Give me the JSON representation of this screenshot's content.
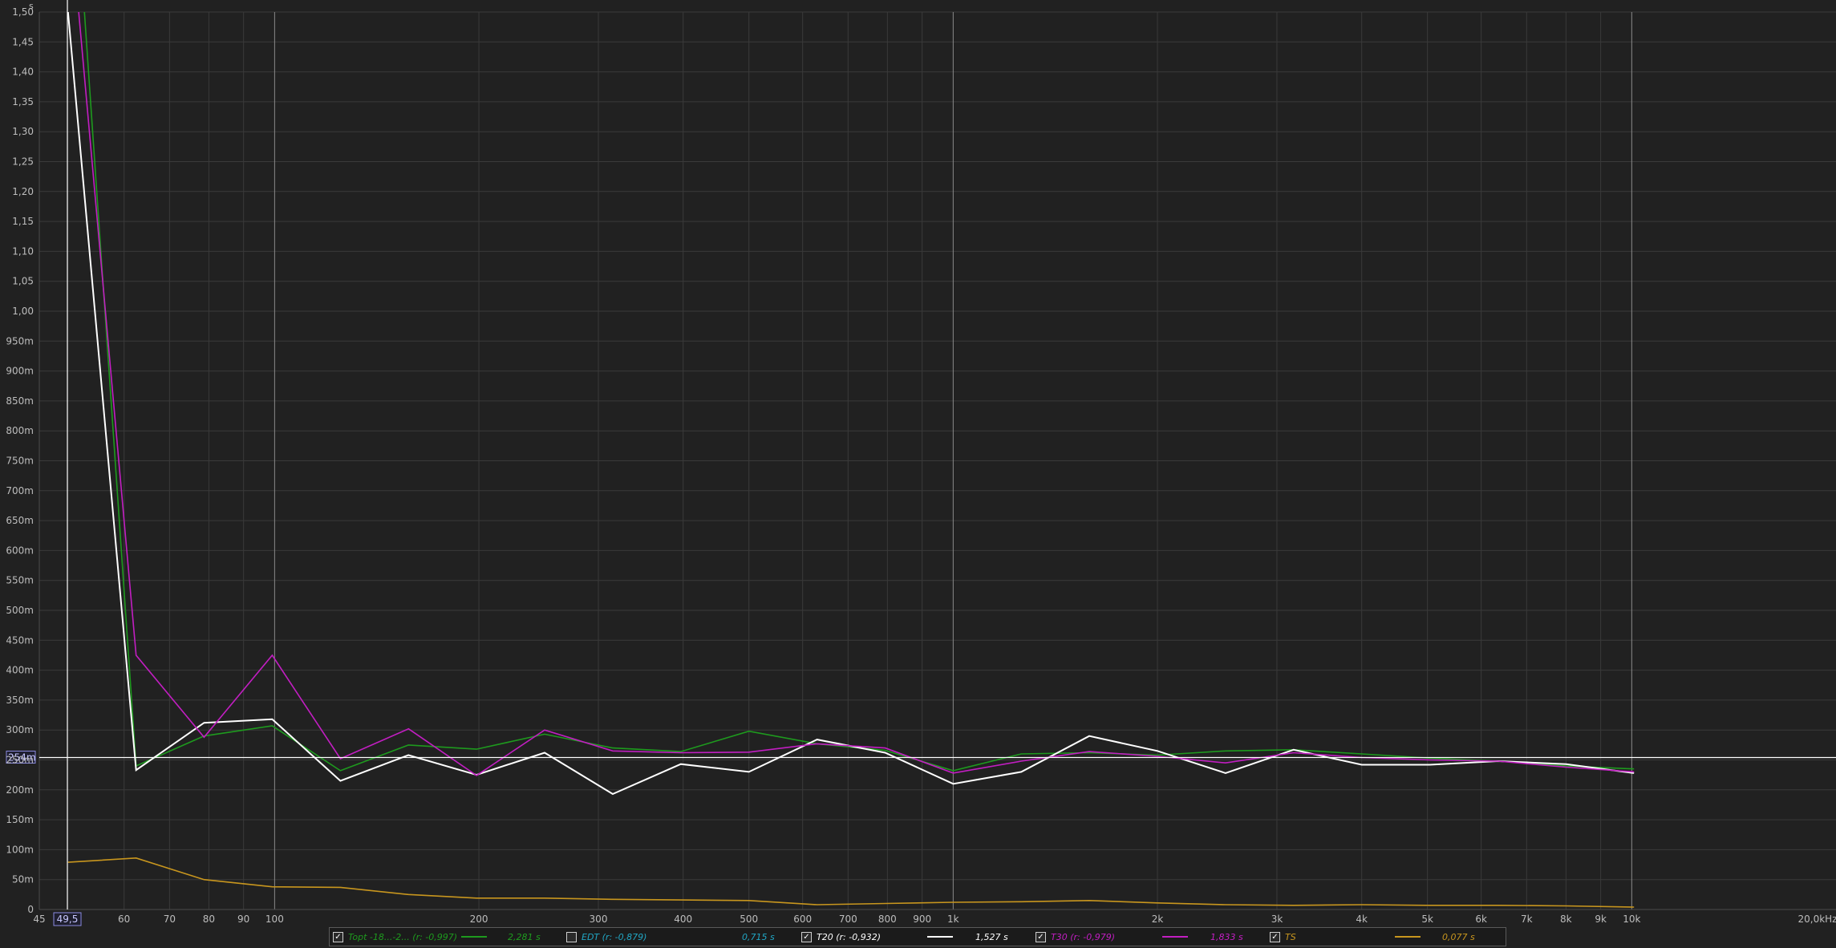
{
  "chart_data": {
    "type": "line",
    "x_scale": "log",
    "xlim": [
      45,
      20000
    ],
    "ylim": [
      0,
      1.5
    ],
    "grid": true,
    "y_unit": "s",
    "x_unit_label": "20,0kHz",
    "y_ticks": [
      {
        "v": 1.5,
        "label": "1,50"
      },
      {
        "v": 1.45,
        "label": "1,45"
      },
      {
        "v": 1.4,
        "label": "1,40"
      },
      {
        "v": 1.35,
        "label": "1,35"
      },
      {
        "v": 1.3,
        "label": "1,30"
      },
      {
        "v": 1.25,
        "label": "1,25"
      },
      {
        "v": 1.2,
        "label": "1,20"
      },
      {
        "v": 1.15,
        "label": "1,15"
      },
      {
        "v": 1.1,
        "label": "1,10"
      },
      {
        "v": 1.05,
        "label": "1,05"
      },
      {
        "v": 1.0,
        "label": "1,00"
      },
      {
        "v": 0.95,
        "label": "950m"
      },
      {
        "v": 0.9,
        "label": "900m"
      },
      {
        "v": 0.85,
        "label": "850m"
      },
      {
        "v": 0.8,
        "label": "800m"
      },
      {
        "v": 0.75,
        "label": "750m"
      },
      {
        "v": 0.7,
        "label": "700m"
      },
      {
        "v": 0.65,
        "label": "650m"
      },
      {
        "v": 0.6,
        "label": "600m"
      },
      {
        "v": 0.55,
        "label": "550m"
      },
      {
        "v": 0.5,
        "label": "500m"
      },
      {
        "v": 0.45,
        "label": "450m"
      },
      {
        "v": 0.4,
        "label": "400m"
      },
      {
        "v": 0.35,
        "label": "350m"
      },
      {
        "v": 0.3,
        "label": "300m"
      },
      {
        "v": 0.25,
        "label": "250m"
      },
      {
        "v": 0.2,
        "label": "200m"
      },
      {
        "v": 0.15,
        "label": "150m"
      },
      {
        "v": 0.1,
        "label": "100m"
      },
      {
        "v": 0.05,
        "label": "50m"
      },
      {
        "v": 0,
        "label": "0"
      }
    ],
    "x_ticks": [
      {
        "v": 45,
        "label": "45"
      },
      {
        "v": 60,
        "label": "60"
      },
      {
        "v": 70,
        "label": "70"
      },
      {
        "v": 80,
        "label": "80"
      },
      {
        "v": 90,
        "label": "90"
      },
      {
        "v": 100,
        "label": "100"
      },
      {
        "v": 200,
        "label": "200"
      },
      {
        "v": 300,
        "label": "300"
      },
      {
        "v": 400,
        "label": "400"
      },
      {
        "v": 500,
        "label": "500"
      },
      {
        "v": 600,
        "label": "600"
      },
      {
        "v": 700,
        "label": "700"
      },
      {
        "v": 800,
        "label": "800"
      },
      {
        "v": 900,
        "label": "900"
      },
      {
        "v": 1000,
        "label": "1k"
      },
      {
        "v": 2000,
        "label": "2k"
      },
      {
        "v": 3000,
        "label": "3k"
      },
      {
        "v": 4000,
        "label": "4k"
      },
      {
        "v": 5000,
        "label": "5k"
      },
      {
        "v": 6000,
        "label": "6k"
      },
      {
        "v": 7000,
        "label": "7k"
      },
      {
        "v": 8000,
        "label": "8k"
      },
      {
        "v": 9000,
        "label": "9k"
      },
      {
        "v": 10000,
        "label": "10k"
      }
    ],
    "major_x_lines": [
      100,
      1000,
      10000
    ],
    "cursor_x": {
      "value": 49.5,
      "label": "49,5"
    },
    "cursor_y": {
      "value": 0.254,
      "label": "254m"
    },
    "x": [
      49.6,
      62.5,
      78.7,
      99.2,
      125,
      157.5,
      198.4,
      250,
      315,
      396.9,
      500,
      630,
      793.7,
      1000,
      1260,
      1587,
      2000,
      2520,
      3175,
      4000,
      5040,
      6350,
      8000,
      10079
    ],
    "series": [
      {
        "name": "Topt -18...-2... (r: -0,997)",
        "color": "#1e9a1e",
        "values": [
          1.9,
          0.24,
          0.29,
          0.307,
          0.232,
          0.275,
          0.268,
          0.293,
          0.27,
          0.264,
          0.298,
          0.277,
          0.266,
          0.232,
          0.26,
          0.262,
          0.258,
          0.265,
          0.267,
          0.26,
          0.253,
          0.248,
          0.24,
          0.235
        ]
      },
      {
        "name": "T20 (r: -0,932)",
        "color": "#ffffff",
        "values": [
          1.5,
          0.233,
          0.312,
          0.318,
          0.215,
          0.258,
          0.225,
          0.262,
          0.193,
          0.243,
          0.23,
          0.284,
          0.262,
          0.21,
          0.23,
          0.29,
          0.265,
          0.228,
          0.267,
          0.242,
          0.242,
          0.248,
          0.243,
          0.228
        ]
      },
      {
        "name": "T30 (r: -0,979)",
        "color": "#c21ec2",
        "values": [
          1.7,
          0.425,
          0.288,
          0.425,
          0.252,
          0.302,
          0.224,
          0.3,
          0.265,
          0.262,
          0.263,
          0.277,
          0.27,
          0.228,
          0.248,
          0.264,
          0.256,
          0.245,
          0.262,
          0.254,
          0.25,
          0.248,
          0.238,
          0.23
        ]
      },
      {
        "name": "TS",
        "color": "#c8961e",
        "values": [
          0.079,
          0.086,
          0.05,
          0.038,
          0.037,
          0.025,
          0.019,
          0.019,
          0.017,
          0.016,
          0.015,
          0.008,
          0.01,
          0.012,
          0.013,
          0.015,
          0.011,
          0.008,
          0.007,
          0.008,
          0.007,
          0.007,
          0.006,
          0.004
        ]
      }
    ]
  },
  "legend": [
    {
      "checked": true,
      "label": "Topt -18...-2... (r: -0,997)",
      "value": "2,281 s",
      "color": "#1e9a1e"
    },
    {
      "checked": false,
      "label": "EDT (r: -0,879)",
      "value": "0,715 s",
      "color": "#21a6c4"
    },
    {
      "checked": true,
      "label": "T20 (r: -0,932)",
      "value": "1,527 s",
      "color": "#ffffff"
    },
    {
      "checked": true,
      "label": "T30 (r: -0,979)",
      "value": "1,833 s",
      "color": "#c21ec2"
    },
    {
      "checked": true,
      "label": "TS",
      "value": "0,077 s",
      "color": "#c8961e"
    }
  ],
  "checkmark": "✓"
}
